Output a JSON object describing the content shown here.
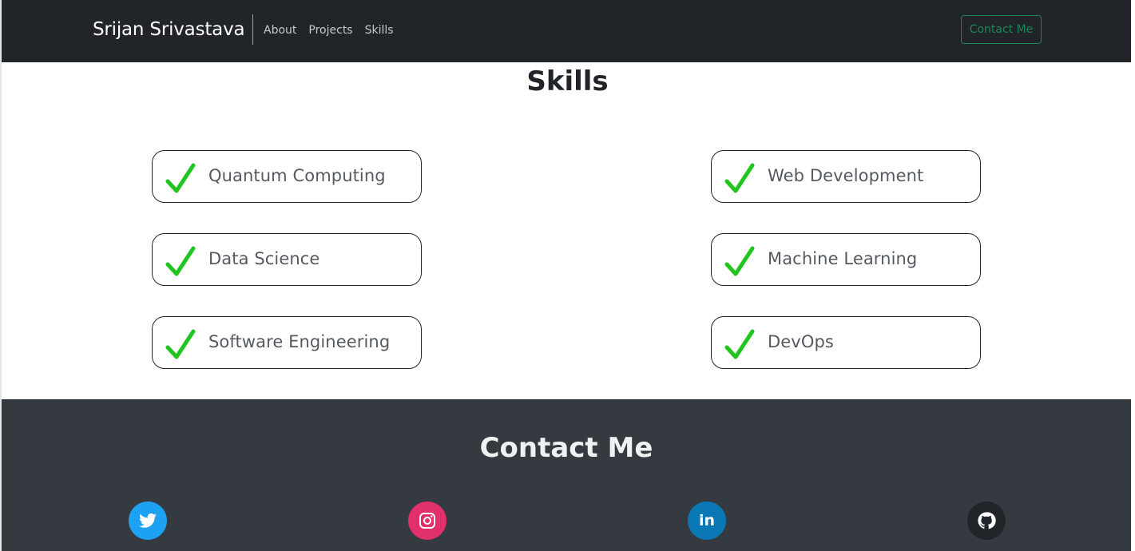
{
  "nav": {
    "brand": "Srijan Srivastava",
    "links": [
      "About",
      "Projects",
      "Skills"
    ],
    "contact_button": "Contact Me"
  },
  "skills": {
    "title": "Skills",
    "items": [
      "Quantum Computing",
      "Web Development",
      "Data Science",
      "Machine Learning",
      "Software Engineering",
      "DevOps"
    ]
  },
  "contact": {
    "title": "Contact Me",
    "social": [
      {
        "icon": "twitter-icon",
        "color": "#1da1f2"
      },
      {
        "icon": "instagram-icon",
        "color": "#e1306c"
      },
      {
        "icon": "linkedin-icon",
        "color": "#0a78b5",
        "glyph": "in"
      },
      {
        "icon": "github-icon",
        "color": "#212529"
      }
    ]
  },
  "colors": {
    "navbar_bg": "#212529",
    "contact_bg": "#343a40",
    "accent_green": "#198754",
    "check_green": "#22c520"
  }
}
